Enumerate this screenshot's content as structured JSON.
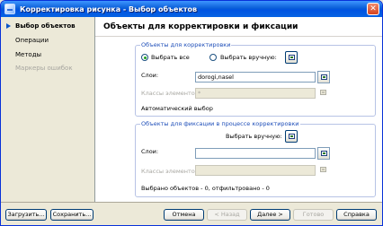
{
  "window": {
    "title": "Корректировка рисунка - Выбор объектов",
    "close": "✕"
  },
  "nav": {
    "items": [
      {
        "label": "Выбор объектов"
      },
      {
        "label": "Операции"
      },
      {
        "label": "Методы"
      },
      {
        "label": "Маркеры ошибок"
      }
    ]
  },
  "page": {
    "title": "Объекты для корректировки и фиксации"
  },
  "correction": {
    "legend": "Объекты для корректировки",
    "radio_all": "Выбрать все",
    "radio_manual": "Выбрать вручную:",
    "layers_label": "Слои:",
    "layers_value": "dorogi,nasel",
    "classes_label": "Классы элементов:",
    "classes_value": "*",
    "auto_select": "Автоматический выбор"
  },
  "fixation": {
    "legend": "Объекты для фиксации в процессе корректировки",
    "manual_label": "Выбрать вручную:",
    "layers_label": "Слои:",
    "layers_value": "",
    "classes_label": "Классы элементов:",
    "classes_value": "",
    "summary": "Выбрано объектов - 0, отфильтровано - 0"
  },
  "buttons": {
    "load": "Загрузить...",
    "save": "Сохранить...",
    "cancel": "Отмена",
    "back": "< Назад",
    "next": "Далее >",
    "finish": "Готово",
    "help": "Справка"
  }
}
